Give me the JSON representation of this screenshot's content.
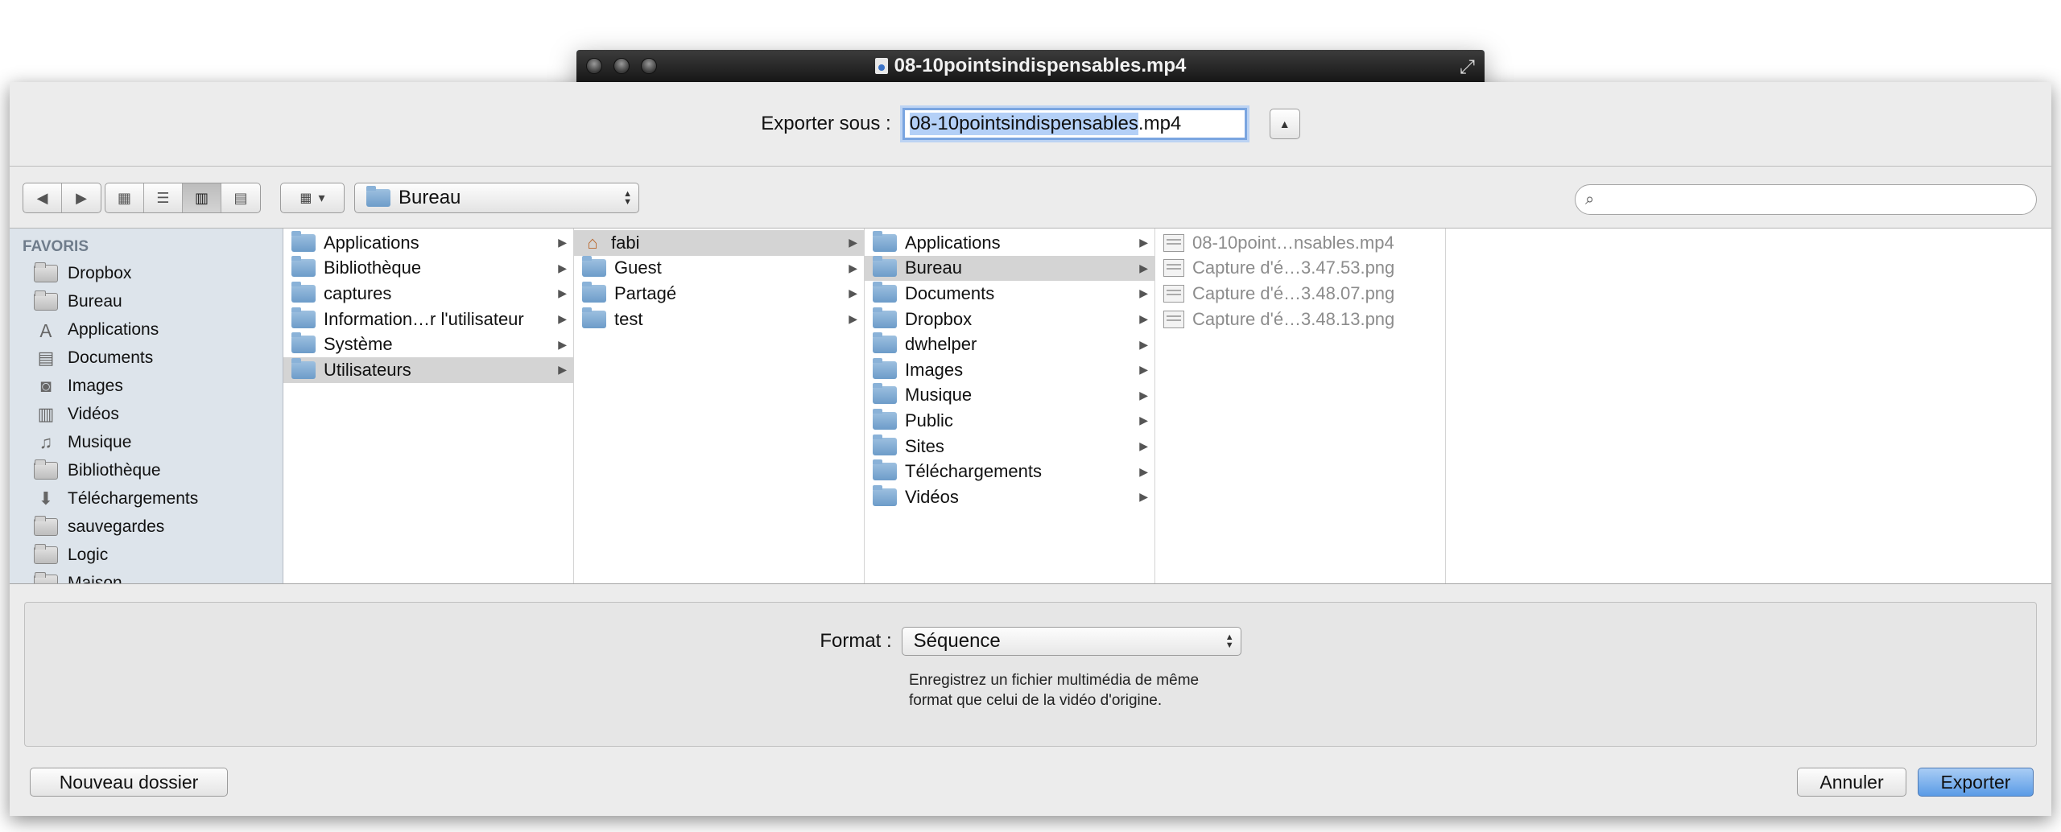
{
  "window": {
    "title": "08-10pointsindispensables.mp4"
  },
  "export": {
    "label": "Exporter sous :",
    "filename_selected": "08-10pointsindispensables",
    "filename_ext": ".mp4"
  },
  "toolbar": {
    "location": "Bureau",
    "view_active": "columns"
  },
  "sidebar": {
    "title": "FAVORIS",
    "items": [
      {
        "label": "Dropbox",
        "icon": "folder-icon"
      },
      {
        "label": "Bureau",
        "icon": "desktop-icon"
      },
      {
        "label": "Applications",
        "icon": "applications-icon"
      },
      {
        "label": "Documents",
        "icon": "documents-icon"
      },
      {
        "label": "Images",
        "icon": "camera-icon"
      },
      {
        "label": "Vidéos",
        "icon": "film-icon"
      },
      {
        "label": "Musique",
        "icon": "music-icon"
      },
      {
        "label": "Bibliothèque",
        "icon": "folder-icon"
      },
      {
        "label": "Téléchargements",
        "icon": "download-icon"
      },
      {
        "label": "sauvegardes",
        "icon": "folder-icon"
      },
      {
        "label": "Logic",
        "icon": "folder-icon"
      },
      {
        "label": "Maison",
        "icon": "folder-icon"
      }
    ]
  },
  "columns": [
    {
      "items": [
        {
          "label": "Applications",
          "selected": false
        },
        {
          "label": "Bibliothèque",
          "selected": false
        },
        {
          "label": "captures",
          "selected": false
        },
        {
          "label": "Information…r l'utilisateur",
          "selected": false
        },
        {
          "label": "Système",
          "selected": false
        },
        {
          "label": "Utilisateurs",
          "selected": true
        }
      ]
    },
    {
      "items": [
        {
          "label": "fabi",
          "selected": true,
          "home": true
        },
        {
          "label": "Guest",
          "selected": false
        },
        {
          "label": "Partagé",
          "selected": false
        },
        {
          "label": "test",
          "selected": false
        }
      ]
    },
    {
      "items": [
        {
          "label": "Applications",
          "selected": false
        },
        {
          "label": "Bureau",
          "selected": true
        },
        {
          "label": "Documents",
          "selected": false
        },
        {
          "label": "Dropbox",
          "selected": false
        },
        {
          "label": "dwhelper",
          "selected": false
        },
        {
          "label": "Images",
          "selected": false
        },
        {
          "label": "Musique",
          "selected": false
        },
        {
          "label": "Public",
          "selected": false
        },
        {
          "label": "Sites",
          "selected": false
        },
        {
          "label": "Téléchargements",
          "selected": false
        },
        {
          "label": "Vidéos",
          "selected": false
        }
      ]
    },
    {
      "files": [
        "08-10point…nsables.mp4",
        "Capture d'é…3.47.53.png",
        "Capture d'é…3.48.07.png",
        "Capture d'é…3.48.13.png"
      ]
    }
  ],
  "format": {
    "label": "Format :",
    "selected": "Séquence",
    "description_line1": "Enregistrez un fichier multimédia de même",
    "description_line2": "format que celui de la vidéo d'origine."
  },
  "buttons": {
    "new_folder": "Nouveau dossier",
    "cancel": "Annuler",
    "export": "Exporter"
  }
}
